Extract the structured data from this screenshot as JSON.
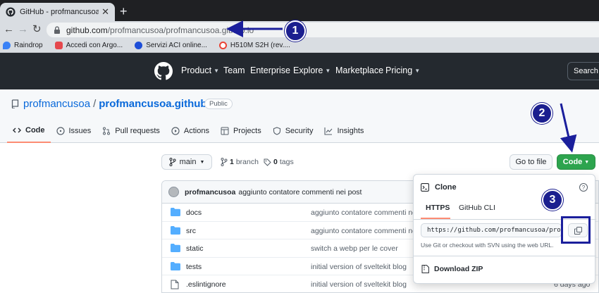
{
  "browser": {
    "tab_title": "GitHub - profmancusoa/profm",
    "url_host": "github.com",
    "url_path": "/profmancusoa/profmancusoa.github.io",
    "bookmarks": [
      {
        "label": "Raindrop",
        "color": "#3b82f6"
      },
      {
        "label": "Accedi con Argo...",
        "color": "#e5484d"
      },
      {
        "label": "Servizi ACI online...",
        "color": "#1d4ed8"
      },
      {
        "label": "H510M S2H (rev....",
        "color": "#ea4335"
      }
    ]
  },
  "github_nav": {
    "items": [
      "Product",
      "Team",
      "Enterprise",
      "Explore",
      "Marketplace",
      "Pricing"
    ],
    "search": "Search"
  },
  "repo": {
    "owner": "profmancusoa",
    "name": "profmancusoa.github.io",
    "visibility": "Public",
    "tabs": [
      "Code",
      "Issues",
      "Pull requests",
      "Actions",
      "Projects",
      "Security",
      "Insights"
    ]
  },
  "toolbar": {
    "branch": "main",
    "branch_count": "1",
    "branch_label": "branch",
    "tag_count": "0",
    "tag_label": "tags",
    "go_to_file": "Go to file",
    "code": "Code"
  },
  "commit": {
    "author": "profmancusoa",
    "message": "aggiunto contatore commenti nei post"
  },
  "files": [
    {
      "name": "docs",
      "type": "dir",
      "message": "aggiunto contatore commenti nei p",
      "age": ""
    },
    {
      "name": "src",
      "type": "dir",
      "message": "aggiunto contatore commenti nei p",
      "age": ""
    },
    {
      "name": "static",
      "type": "dir",
      "message": "switch a webp per le cover",
      "age": ""
    },
    {
      "name": "tests",
      "type": "dir",
      "message": "initial version of sveltekit blog",
      "age": ""
    },
    {
      "name": ".eslintignore",
      "type": "file",
      "message": "initial version of sveltekit blog",
      "age": "6 days ago"
    }
  ],
  "clone": {
    "title": "Clone",
    "tab_https": "HTTPS",
    "tab_cli": "GitHub CLI",
    "url": "https://github.com/profmancusoa/profmancusoa.github.io.git",
    "hint": "Use Git or checkout with SVN using the web URL.",
    "download_zip": "Download ZIP"
  },
  "annotations": {
    "badge1": "1",
    "badge2": "2",
    "badge3": "3",
    "color": "#1b1f8f"
  }
}
